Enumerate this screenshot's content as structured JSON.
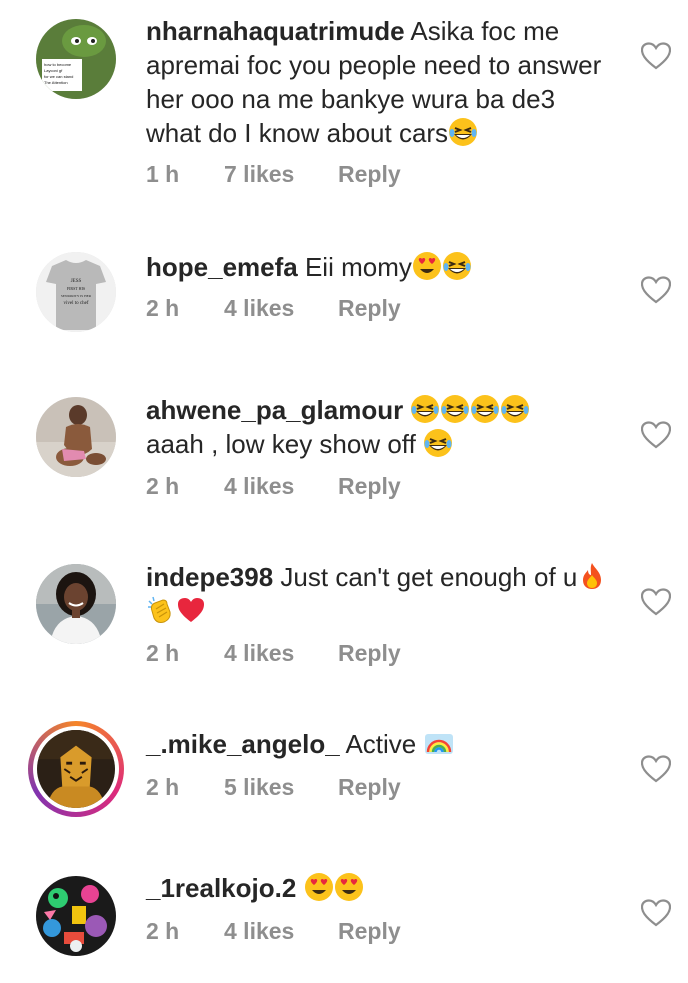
{
  "comments": [
    {
      "username": "nharnahaquatrimude",
      "text": "Asika foc me apremai foc you people need to answer her ooo na me bankye wura ba de3 what do I know about cars",
      "emojis_after": [
        "grinning-squint-tears"
      ],
      "time": "1 h",
      "likes": "7 likes",
      "reply": "Reply"
    },
    {
      "username": "hope_emefa",
      "text": "Eii momy",
      "emojis_after": [
        "heart-eyes",
        "grinning-squint-tears"
      ],
      "time": "2 h",
      "likes": "4 likes",
      "reply": "Reply"
    },
    {
      "username": "ahwene_pa_glamour",
      "text": "",
      "emojis_inline": [
        "grinning-squint-tears",
        "grinning-squint-tears",
        "grinning-squint-tears",
        "grinning-squint-tears"
      ],
      "line2": "aaah , low key show off",
      "emojis_after": [
        "grinning-squint-tears"
      ],
      "time": "2 h",
      "likes": "4 likes",
      "reply": "Reply"
    },
    {
      "username": "indepe398",
      "text": "Just can't get enough of u",
      "emojis_after": [
        "fire",
        "clapping-hands",
        "red-heart"
      ],
      "time": "2 h",
      "likes": "4 likes",
      "reply": "Reply"
    },
    {
      "username": "_.mike_angelo_",
      "text": "Active",
      "emojis_after": [
        "rainbow"
      ],
      "time": "2 h",
      "likes": "5 likes",
      "reply": "Reply"
    },
    {
      "username": "_1realkojo.2",
      "text": "",
      "emojis_after": [
        "heart-eyes",
        "heart-eyes"
      ],
      "time": "2 h",
      "likes": "4 likes",
      "reply": "Reply"
    }
  ],
  "avatar_texts": {
    "c1": [
      "how to become",
      "Layconi gf",
      "for we can stand",
      "The Attention"
    ],
    "c2": [
      "JESS",
      "FIRST HIS",
      "SENIORITY IS HER",
      "vivel to chef"
    ]
  },
  "colors": {
    "text": "#262626",
    "meta": "#8e8e8e",
    "story_ring": [
      "#f58529",
      "#dd2a7b",
      "#8134af"
    ]
  }
}
